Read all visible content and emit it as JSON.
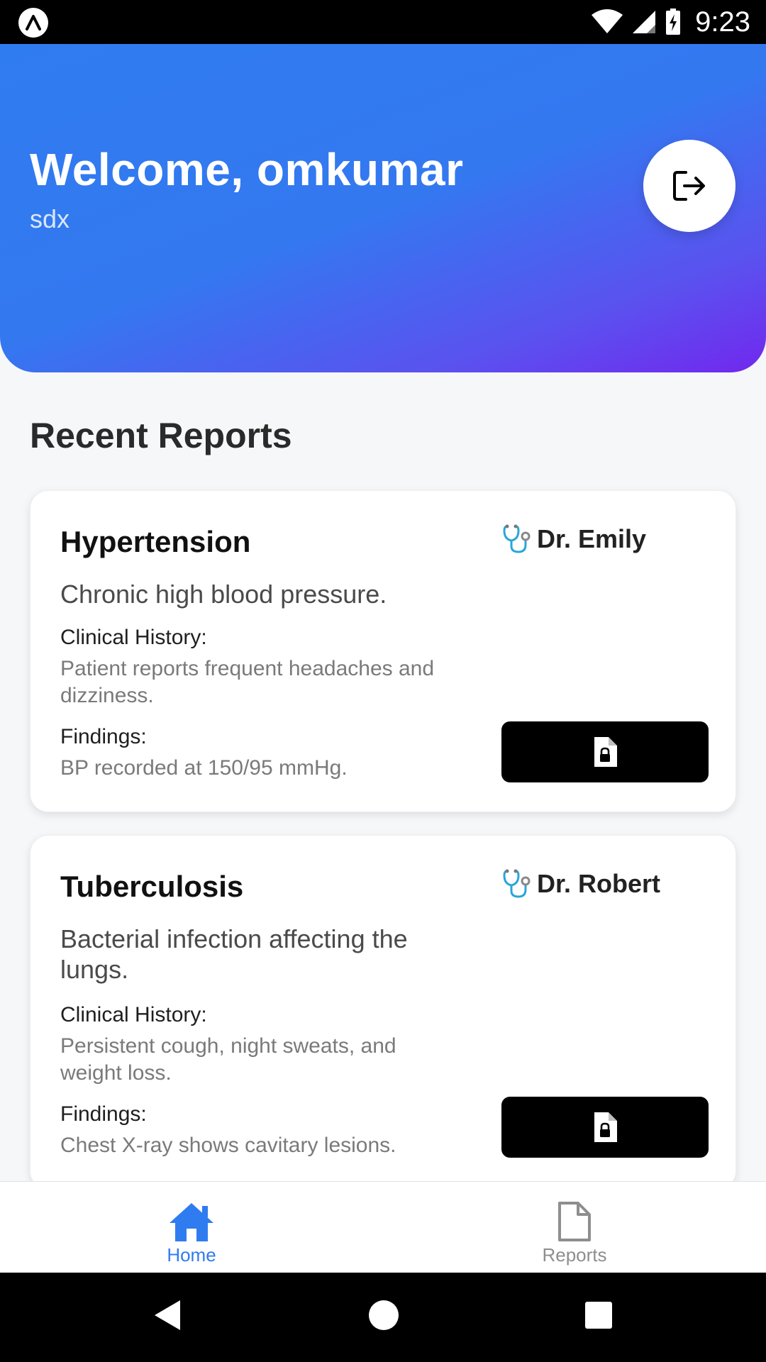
{
  "status_bar": {
    "time": "9:23"
  },
  "header": {
    "welcome": "Welcome, omkumar",
    "subtitle": "sdx",
    "logout_icon": "logout-icon",
    "gradient": [
      "#2f7cf0",
      "#7128ee"
    ]
  },
  "section": {
    "title": "Recent Reports"
  },
  "reports": [
    {
      "title": "Hypertension",
      "doctor": "Dr. Emily",
      "description": "Chronic high blood pressure.",
      "history_label": "Clinical History:",
      "history": "Patient reports frequent headaches and dizziness.",
      "findings_label": "Findings:",
      "findings": "BP recorded at 150/95 mmHg."
    },
    {
      "title": "Tuberculosis",
      "doctor": "Dr. Robert",
      "description": "Bacterial infection affecting the lungs.",
      "history_label": "Clinical History:",
      "history": "Persistent cough, night sweats, and weight loss.",
      "findings_label": "Findings:",
      "findings": "Chest X-ray shows cavitary lesions."
    }
  ],
  "bottom_nav": {
    "items": [
      {
        "label": "Home",
        "icon": "home-icon",
        "active": true
      },
      {
        "label": "Reports",
        "icon": "document-icon",
        "active": false
      }
    ],
    "active_color": "#2f7cf0",
    "inactive_color": "#8e8e8e"
  }
}
